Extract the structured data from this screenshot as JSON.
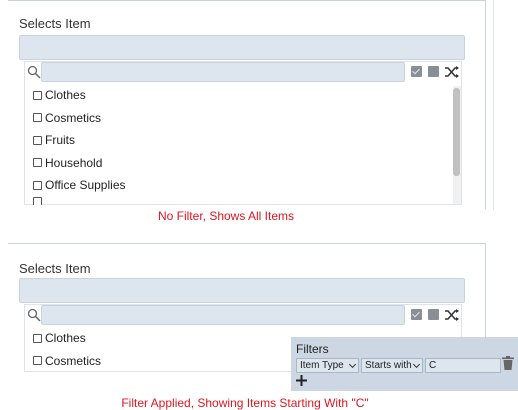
{
  "top_panel": {
    "label": "Selects Item",
    "search_placeholder": "",
    "items": [
      "Clothes",
      "Cosmetics",
      "Fruits",
      "Household",
      "Office Supplies",
      ""
    ],
    "caption": "No Filter, Shows All Items"
  },
  "bottom_panel": {
    "label": "Selects Item",
    "search_placeholder": "",
    "items": [
      "Clothes",
      "Cosmetics"
    ],
    "caption": "Filter Applied, Showing Items Starting With \"C\""
  },
  "filters": {
    "title": "Filters",
    "field": "Item Type",
    "operator": "Starts with",
    "value": "C"
  },
  "colors": {
    "caption": "#e0151f",
    "input_bg": "#dde5ee",
    "filter_panel_bg": "#cdd7e3"
  },
  "icons": {
    "search": "search-icon",
    "select_all": "check-square-icon",
    "deselect": "square-icon",
    "shuffle": "shuffle-icon",
    "delete": "trash-icon",
    "add": "plus-icon"
  }
}
